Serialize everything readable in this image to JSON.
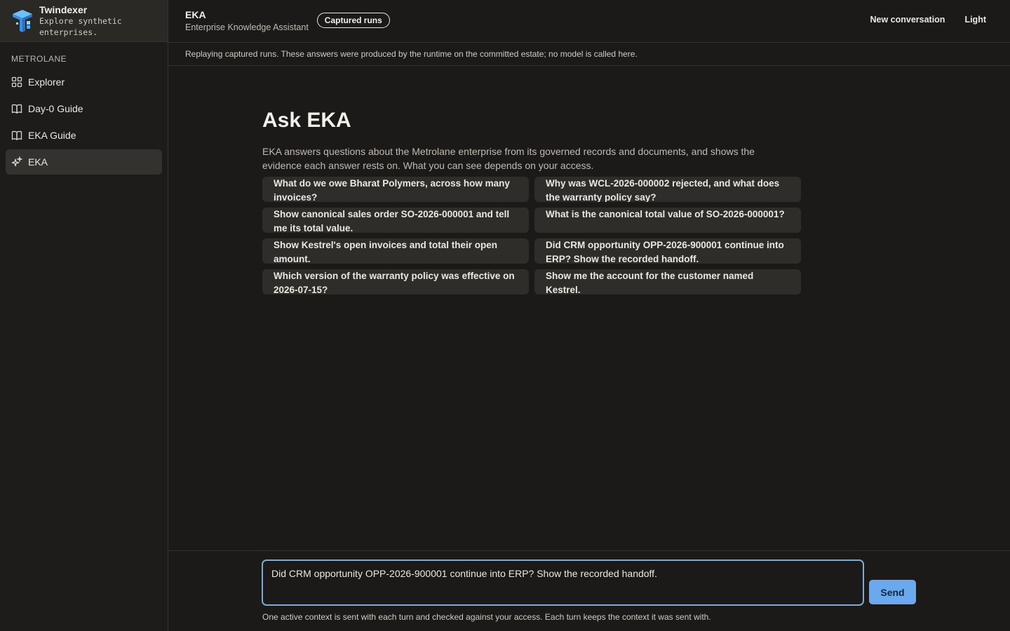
{
  "brand": {
    "name": "Twindexer",
    "tagline": "Explore synthetic enterprises."
  },
  "sidebar": {
    "section_label": "METROLANE",
    "items": [
      {
        "label": "Explorer",
        "icon": "grid-icon"
      },
      {
        "label": "Day-0 Guide",
        "icon": "book-icon"
      },
      {
        "label": "EKA Guide",
        "icon": "book-icon"
      },
      {
        "label": "EKA",
        "icon": "sparkle-icon",
        "active": true
      }
    ]
  },
  "header": {
    "title": "EKA",
    "subtitle": "Enterprise Knowledge Assistant",
    "badge": "Captured runs",
    "actions": {
      "new_conversation": "New conversation",
      "theme": "Light"
    }
  },
  "notice": "Replaying captured runs. These answers were produced by the runtime on the committed estate; no model is called here.",
  "main": {
    "title": "Ask EKA",
    "intro": "EKA answers questions about the Metrolane enterprise from its governed records and documents, and shows the evidence each answer rests on. What you can see depends on your access.",
    "suggestions": [
      "What do we owe Bharat Polymers, across how many invoices?",
      "Why was WCL-2026-000002 rejected, and what does the warranty policy say?",
      "Show canonical sales order SO-2026-000001 and tell me its total value.",
      "What is the canonical total value of SO-2026-000001?",
      "Show Kestrel's open invoices and total their open amount.",
      "Did CRM opportunity OPP-2026-900001 continue into ERP? Show the recorded handoff.",
      "Which version of the warranty policy was effective on 2026-07-15?",
      "Show me the account for the customer named Kestrel."
    ]
  },
  "composer": {
    "value": "Did CRM opportunity OPP-2026-900001 continue into ERP? Show the recorded handoff.",
    "send_label": "Send",
    "note": "One active context is sent with each turn and checked against your access. Each turn keeps the context it was sent with."
  },
  "colors": {
    "background": "#1b1a18",
    "accent": "#6aa9f0",
    "focus_ring": "#7fa9d6"
  }
}
